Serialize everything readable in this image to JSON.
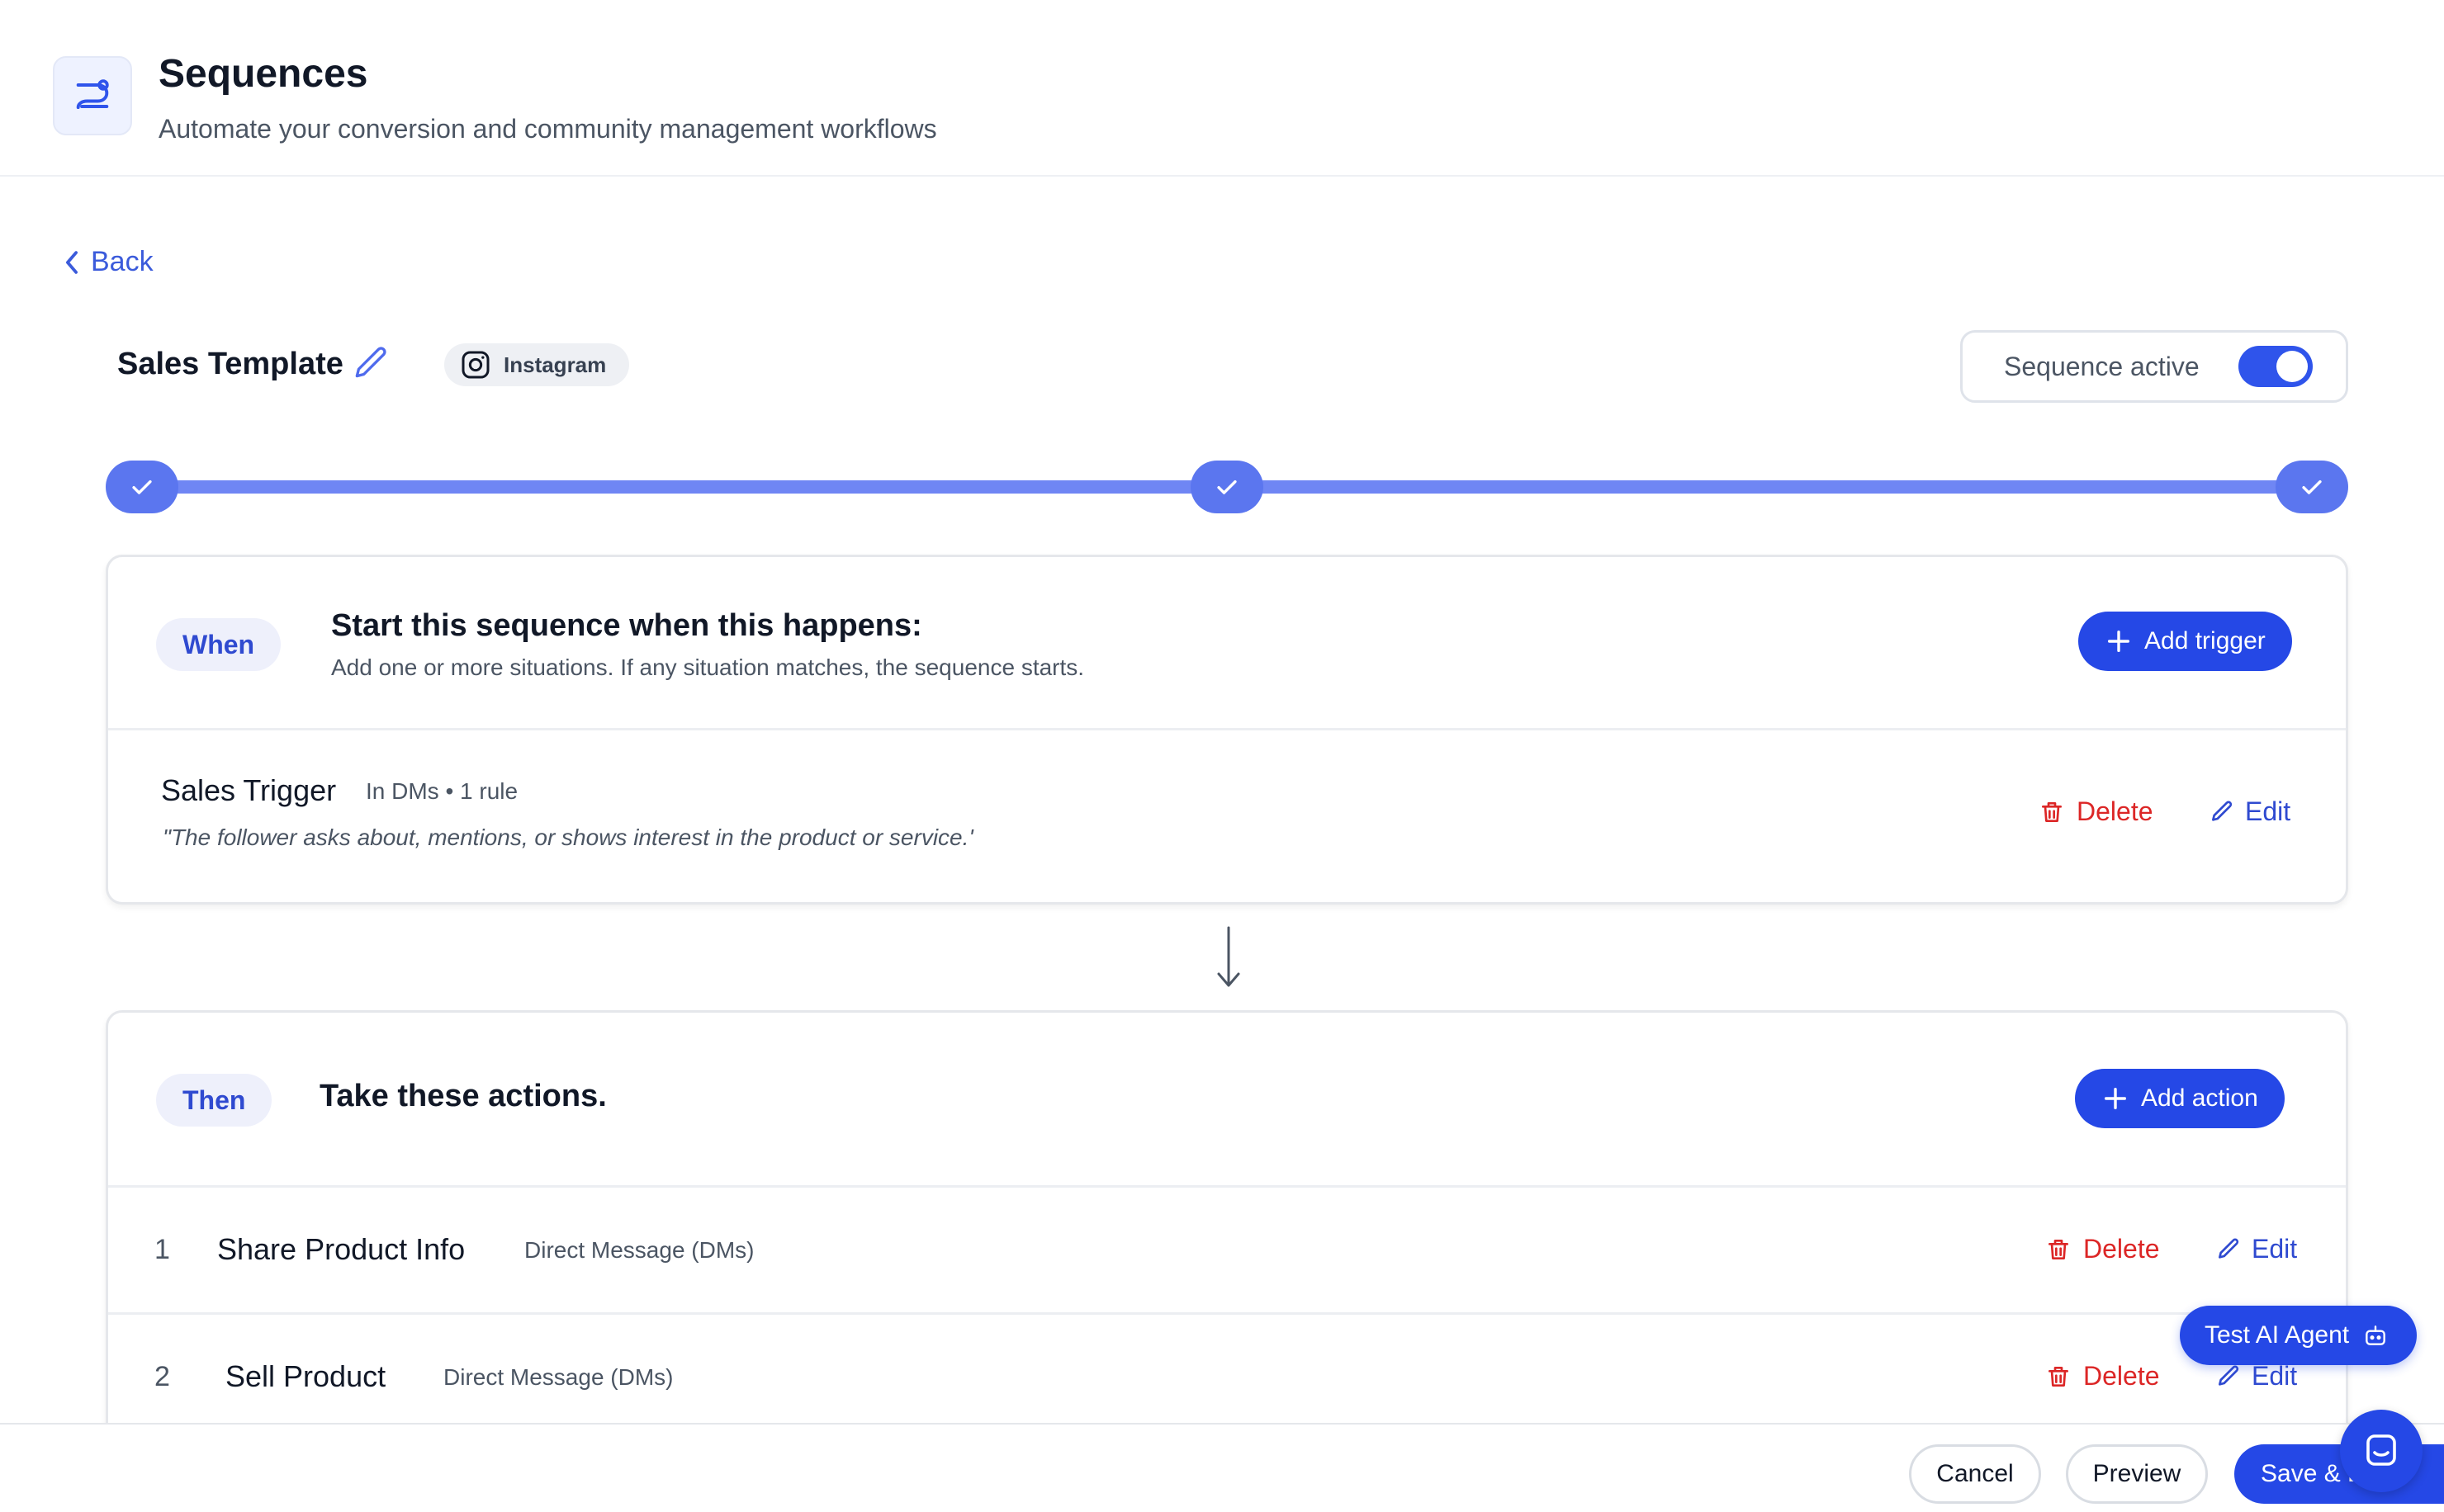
{
  "header": {
    "title": "Sequences",
    "subtitle": "Automate your conversion and community management workflows"
  },
  "nav": {
    "back_label": "Back"
  },
  "sequence": {
    "name": "Sales Template",
    "channel": "Instagram",
    "active_label": "Sequence active",
    "active": true
  },
  "progress": {
    "steps_completed": 3,
    "steps_total": 3
  },
  "when_card": {
    "tag": "When",
    "heading": "Start this sequence when this happens:",
    "description": "Add one or more situations. If any situation matches, the sequence starts.",
    "add_label": "Add trigger",
    "trigger": {
      "title": "Sales Trigger",
      "meta": "In DMs • 1 rule",
      "quote": "\"The follower asks about, mentions, or shows interest in the product or service.'",
      "delete_label": "Delete",
      "edit_label": "Edit"
    }
  },
  "then_card": {
    "tag": "Then",
    "heading": "Take these actions.",
    "add_label": "Add action",
    "actions": [
      {
        "num": "1",
        "title": "Share Product Info",
        "type": "Direct Message (DMs)",
        "delete_label": "Delete",
        "edit_label": "Edit"
      },
      {
        "num": "2",
        "title": "Sell Product",
        "type": "Direct Message (DMs)",
        "delete_label": "Delete",
        "edit_label": "Edit"
      }
    ]
  },
  "floating": {
    "test_agent_label": "Test AI Agent"
  },
  "footer": {
    "cancel_label": "Cancel",
    "preview_label": "Preview",
    "save_label": "Save & E"
  },
  "colors": {
    "primary": "#2548e6",
    "accent": "#5b76ef",
    "danger": "#dc2626",
    "link": "#3b5bdb"
  }
}
